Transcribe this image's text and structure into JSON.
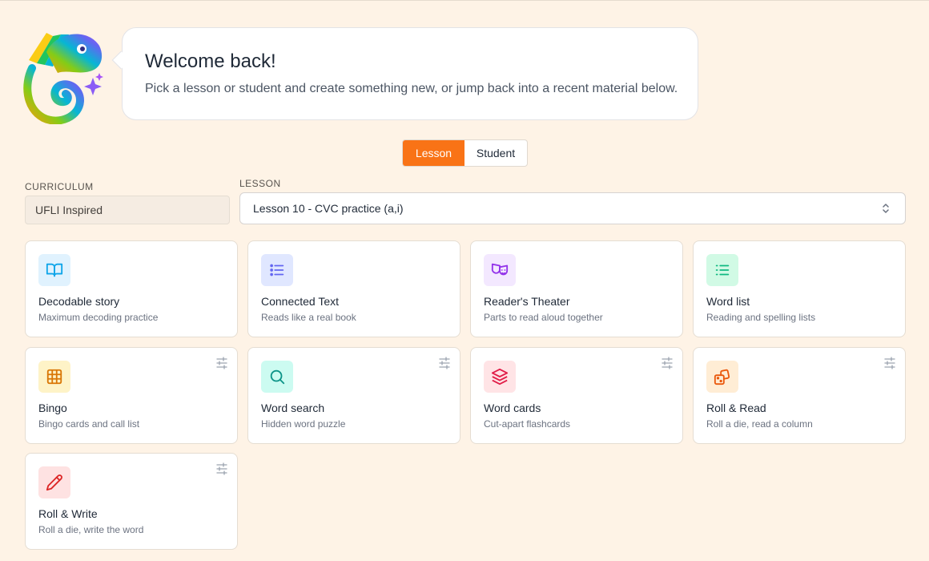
{
  "welcome": {
    "title": "Welcome back!",
    "subtitle": "Pick a lesson or student and create something new, or jump back into a recent material below."
  },
  "mode_toggle": {
    "options": [
      "Lesson",
      "Student"
    ],
    "selected": "Lesson"
  },
  "curriculum": {
    "label": "CURRICULUM",
    "value": "UFLI Inspired"
  },
  "lesson": {
    "label": "LESSON",
    "value": "Lesson 10 - CVC practice (a,i)"
  },
  "cards": [
    {
      "title": "Decodable story",
      "subtitle": "Maximum decoding practice",
      "icon": "book-open-icon",
      "icon_color": "#0ea5e9",
      "icon_bg": "#e0f2fe",
      "has_options": false
    },
    {
      "title": "Connected Text",
      "subtitle": "Reads like a real book",
      "icon": "list-icon",
      "icon_color": "#6366f1",
      "icon_bg": "#e0e7ff",
      "has_options": false
    },
    {
      "title": "Reader's Theater",
      "subtitle": "Parts to read aloud together",
      "icon": "theater-masks-icon",
      "icon_color": "#9333ea",
      "icon_bg": "#f3e8ff",
      "has_options": false
    },
    {
      "title": "Word list",
      "subtitle": "Reading and spelling lists",
      "icon": "list-icon",
      "icon_color": "#10b981",
      "icon_bg": "#d1fae5",
      "has_options": false
    },
    {
      "title": "Bingo",
      "subtitle": "Bingo cards and call list",
      "icon": "grid-icon",
      "icon_color": "#d97706",
      "icon_bg": "#fef3c7",
      "has_options": true
    },
    {
      "title": "Word search",
      "subtitle": "Hidden word puzzle",
      "icon": "search-icon",
      "icon_color": "#0d9488",
      "icon_bg": "#ccfbf1",
      "has_options": true
    },
    {
      "title": "Word cards",
      "subtitle": "Cut-apart flashcards",
      "icon": "layers-icon",
      "icon_color": "#e11d48",
      "icon_bg": "#ffe4e6",
      "has_options": true
    },
    {
      "title": "Roll & Read",
      "subtitle": "Roll a die, read a column",
      "icon": "dice-icon",
      "icon_color": "#ea580c",
      "icon_bg": "#ffedd5",
      "has_options": true
    },
    {
      "title": "Roll & Write",
      "subtitle": "Roll a die, write the word",
      "icon": "pencil-icon",
      "icon_color": "#dc2626",
      "icon_bg": "#fee2e2",
      "has_options": true
    }
  ],
  "colors": {
    "accent": "#f97316",
    "background": "#fef3e6"
  }
}
